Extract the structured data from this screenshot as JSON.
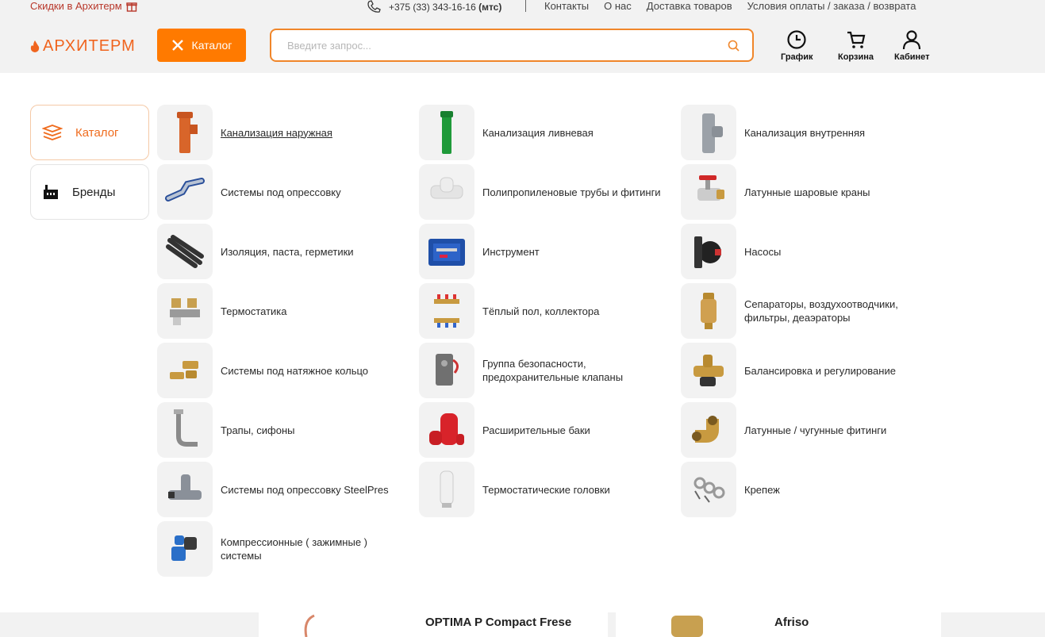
{
  "topbar": {
    "promo": "Скидки в Архитерм",
    "phone": "+375 (33) 343-16-16",
    "operator": "(мтс)",
    "links": [
      "Контакты",
      "О нас",
      "Доставка товаров",
      "Условия оплаты / заказа / возврата"
    ]
  },
  "header": {
    "logo": "АРХИТЕРМ",
    "catalog_button": "Каталог",
    "search_placeholder": "Введите запрос...",
    "icons": {
      "schedule": "График",
      "cart": "Корзина",
      "cabinet": "Кабинет"
    }
  },
  "sidebar": {
    "items": [
      {
        "label": "Каталог",
        "icon": "stack-icon"
      },
      {
        "label": "Бренды",
        "icon": "factory-icon"
      }
    ]
  },
  "catalog": {
    "col1": [
      "Канализация наружная",
      "Системы под опрессовку",
      "Изоляция, паста, герметики",
      "Термостатика",
      "Системы под натяжное кольцо",
      "Трапы, сифоны",
      "Системы под опрессовку SteelPres",
      "Компрессионные ( зажимные ) системы"
    ],
    "col2": [
      "Канализация ливневая",
      "Полипропиленовые трубы и фитинги",
      "Инструмент",
      "Тёплый пол, коллектора",
      "Группа безопасности, предохранительные клапаны",
      "Расширительные баки",
      "Термостатические головки"
    ],
    "col3": [
      "Канализация внутренняя",
      "Латунные шаровые краны",
      "Насосы",
      "Сепараторы, воздухоотводчики, фильтры, деаэраторы",
      "Балансировка и регулирование",
      "Латунные / чугунные фитинги",
      "Крепеж"
    ]
  },
  "bottom": {
    "card1_title": "OPTIMA P Compact Frese",
    "card2_title": "Afriso"
  },
  "colors": {
    "accent": "#ff7a00",
    "logo": "#f0641e",
    "promo": "#b8372a"
  }
}
